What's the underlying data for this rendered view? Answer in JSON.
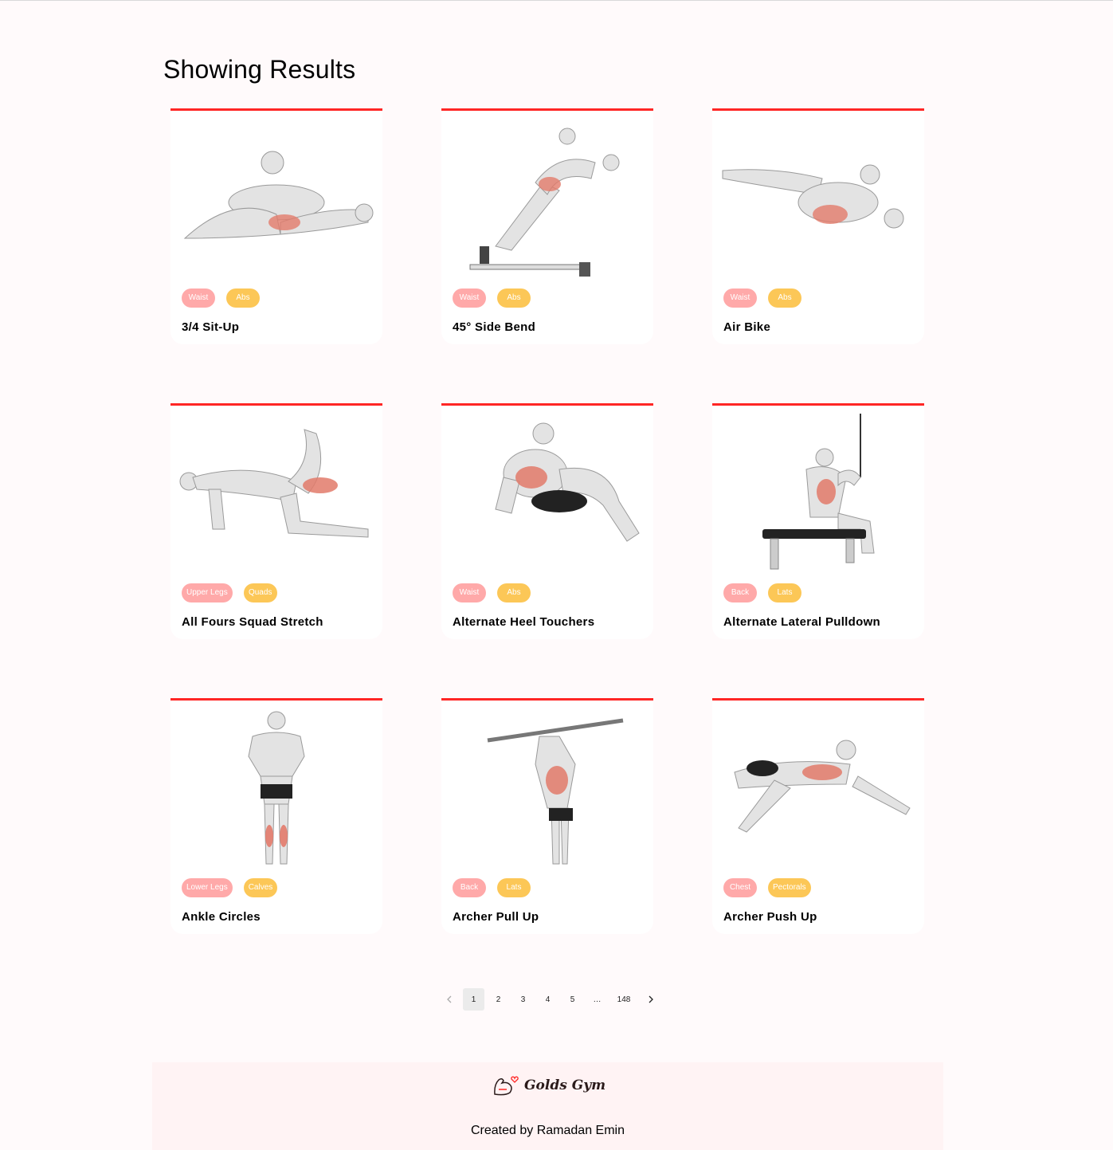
{
  "heading": "Showing Results",
  "exercises": [
    {
      "name": "3/4 Sit-Up",
      "body_part": "Waist",
      "target": "Abs"
    },
    {
      "name": "45° Side Bend",
      "body_part": "Waist",
      "target": "Abs"
    },
    {
      "name": "Air Bike",
      "body_part": "Waist",
      "target": "Abs"
    },
    {
      "name": "All Fours Squad Stretch",
      "body_part": "Upper Legs",
      "target": "Quads"
    },
    {
      "name": "Alternate Heel Touchers",
      "body_part": "Waist",
      "target": "Abs"
    },
    {
      "name": "Alternate Lateral Pulldown",
      "body_part": "Back",
      "target": "Lats"
    },
    {
      "name": "Ankle Circles",
      "body_part": "Lower Legs",
      "target": "Calves"
    },
    {
      "name": "Archer Pull Up",
      "body_part": "Back",
      "target": "Lats"
    },
    {
      "name": "Archer Push Up",
      "body_part": "Chest",
      "target": "Pectorals"
    }
  ],
  "pagination": {
    "prev_icon": "chevron-left-icon",
    "next_icon": "chevron-right-icon",
    "pages": [
      "1",
      "2",
      "3",
      "4",
      "5"
    ],
    "ellipsis": "…",
    "last_page": "148",
    "current": "1"
  },
  "footer": {
    "logo_text": "Golds Gym",
    "logo_icon": "flexing-arm-heart-icon",
    "credit": "Created by Ramadan Emin"
  },
  "colors": {
    "accent": "#ff2625",
    "body_part_tag": "#ffa9a9",
    "target_tag": "#fcc757",
    "page_background": "#fffafb",
    "footer_background": "#fff3f4"
  }
}
